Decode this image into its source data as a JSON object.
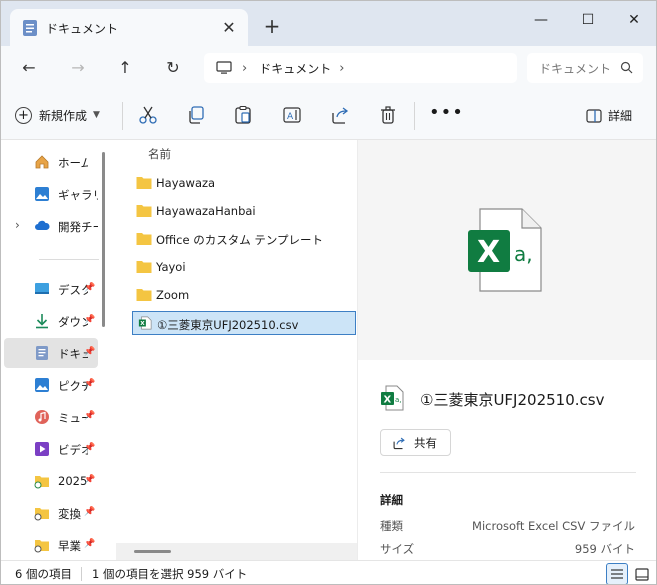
{
  "window": {
    "tab_title": "ドキュメント",
    "tab_close": "✕",
    "new_tab": "+",
    "minimize": "—",
    "maximize": "☐",
    "close": "✕"
  },
  "nav": {
    "back": "←",
    "forward": "→",
    "up": "↑",
    "refresh": "↻",
    "address_segments": [
      "ドキュメント"
    ],
    "search_placeholder": "ドキュメント"
  },
  "commandbar": {
    "new_label": "新規作成",
    "details_label": "詳細",
    "more_label": "•••"
  },
  "sidebar": {
    "items": [
      {
        "label": "ホーム",
        "icon": "home-icon"
      },
      {
        "label": "ギャラリー",
        "icon": "gallery-icon"
      },
      {
        "label": "開発チー",
        "icon": "cloud-icon"
      },
      {
        "label": "デスク",
        "icon": "desktop-icon"
      },
      {
        "label": "ダウン",
        "icon": "download-icon"
      },
      {
        "label": "ドキュ",
        "icon": "document-icon"
      },
      {
        "label": "ピクチ",
        "icon": "pictures-icon"
      },
      {
        "label": "ミュー",
        "icon": "music-icon"
      },
      {
        "label": "ビデオ",
        "icon": "video-icon"
      },
      {
        "label": "2025",
        "icon": "folder-icon"
      },
      {
        "label": "変換",
        "icon": "folder-icon"
      },
      {
        "label": "早業",
        "icon": "folder-icon"
      }
    ]
  },
  "filelist": {
    "column_name": "名前",
    "files": [
      {
        "name": "Hayawaza",
        "type": "folder"
      },
      {
        "name": "HayawazaHanbai",
        "type": "folder"
      },
      {
        "name": "Office のカスタム テンプレート",
        "type": "folder"
      },
      {
        "name": "Yayoi",
        "type": "folder"
      },
      {
        "name": "Zoom",
        "type": "folder"
      },
      {
        "name": "①三菱東京UFJ202510.csv",
        "type": "csv"
      }
    ]
  },
  "details": {
    "file_name": "①三菱東京UFJ202510.csv",
    "share_label": "共有",
    "heading": "詳細",
    "props": [
      {
        "key": "種類",
        "value": "Microsoft Excel CSV ファイル"
      },
      {
        "key": "サイズ",
        "value": "959 バイト"
      }
    ]
  },
  "statusbar": {
    "item_count": "6 個の項目",
    "selection": "1 個の項目を選択  959 バイト"
  },
  "colors": {
    "accent": "#3d7fc4",
    "excel_green": "#107c41",
    "folder_yellow": "#f4c542"
  }
}
